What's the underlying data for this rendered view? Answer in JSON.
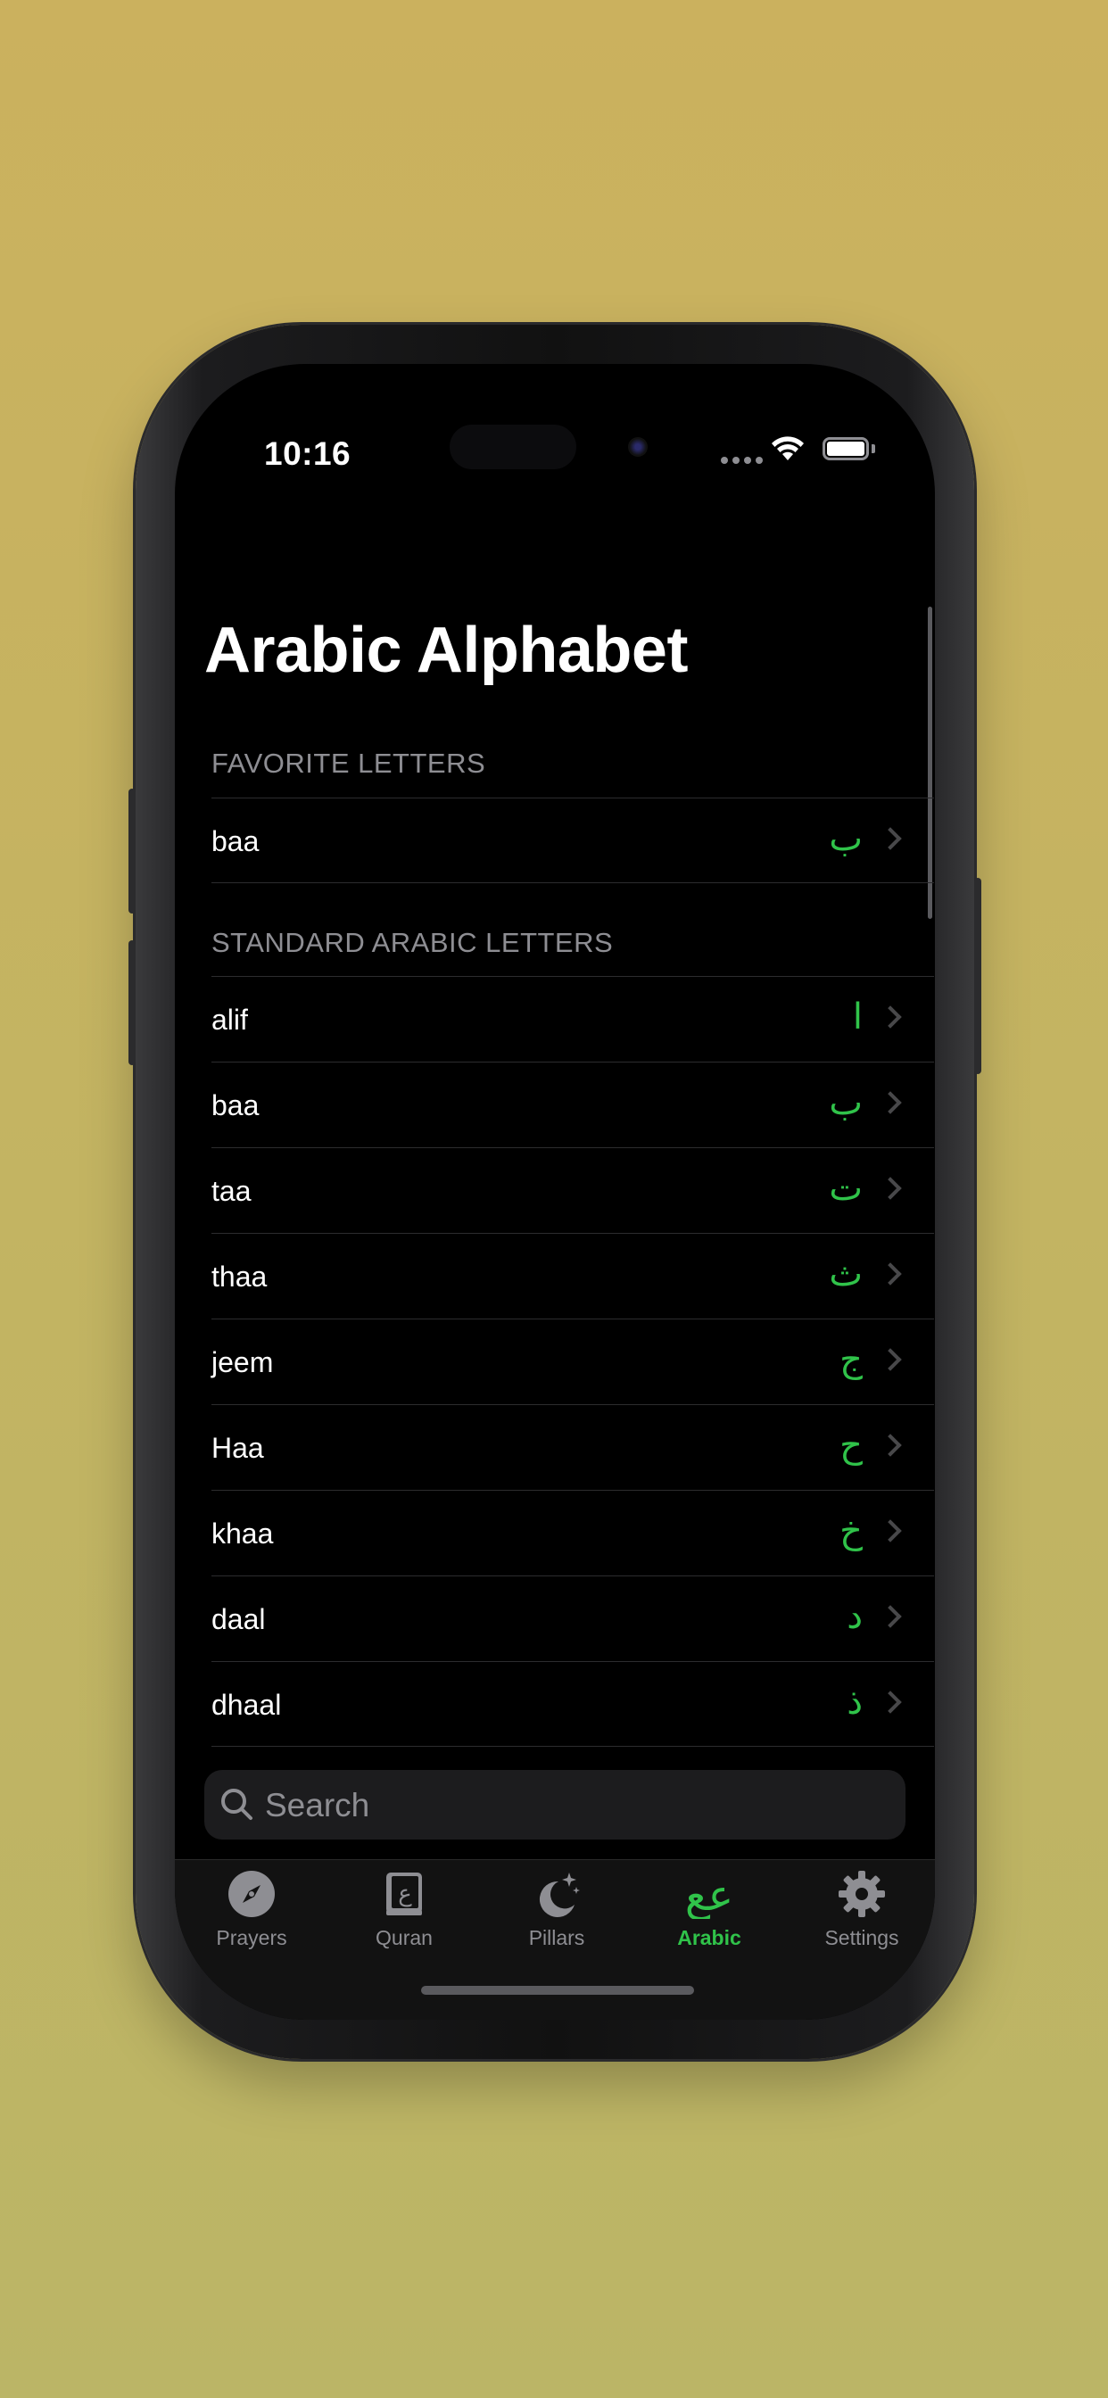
{
  "status_bar": {
    "time": "10:16"
  },
  "page": {
    "title": "Arabic Alphabet"
  },
  "favorites": {
    "header": "FAVORITE LETTERS",
    "items": [
      {
        "name": "baa",
        "letter": "ب"
      }
    ]
  },
  "standard": {
    "header": "STANDARD ARABIC LETTERS",
    "items": [
      {
        "name": "alif",
        "letter": "ا"
      },
      {
        "name": "baa",
        "letter": "ب"
      },
      {
        "name": "taa",
        "letter": "ت"
      },
      {
        "name": "thaa",
        "letter": "ث"
      },
      {
        "name": "jeem",
        "letter": "ج"
      },
      {
        "name": "Haa",
        "letter": "ح"
      },
      {
        "name": "khaa",
        "letter": "خ"
      },
      {
        "name": "daal",
        "letter": "د"
      },
      {
        "name": "dhaal",
        "letter": "ذ"
      }
    ]
  },
  "search": {
    "placeholder": "Search"
  },
  "tabbar": {
    "tabs": [
      {
        "label": "Prayers",
        "icon": "compass-icon",
        "active": false
      },
      {
        "label": "Quran",
        "icon": "book-icon",
        "active": false
      },
      {
        "label": "Pillars",
        "icon": "moon-stars-icon",
        "active": false
      },
      {
        "label": "Arabic",
        "icon": "arabic-letters-icon",
        "active": true
      },
      {
        "label": "Settings",
        "icon": "gear-icon",
        "active": false
      }
    ]
  },
  "colors": {
    "accent": "#30c34a",
    "background": "#000000",
    "secondary_text": "#8e8e93"
  }
}
